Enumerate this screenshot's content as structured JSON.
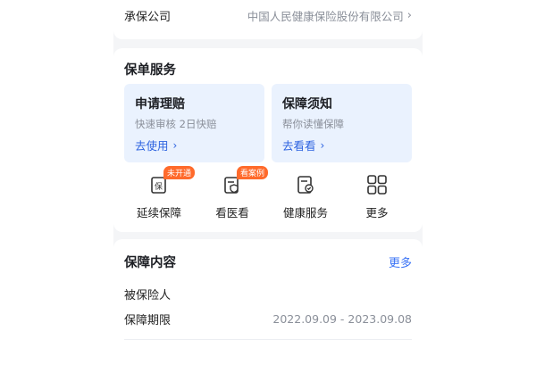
{
  "insurer": {
    "label": "承保公司",
    "value": "中国人民健康保险股份有限公司"
  },
  "policy_services": {
    "title": "保单服务",
    "tiles": [
      {
        "title": "申请理赔",
        "subtitle": "快速审核 2日快赔",
        "link": "去使用"
      },
      {
        "title": "保障须知",
        "subtitle": "帮你读懂保障",
        "link": "去看看"
      }
    ],
    "services": [
      {
        "label": "延续保障",
        "badge": "未开通",
        "icon": "policy-renew-icon"
      },
      {
        "label": "看医看",
        "badge": "看案例",
        "icon": "medical-shield-icon"
      },
      {
        "label": "健康服务",
        "badge": "",
        "icon": "health-doc-icon"
      },
      {
        "label": "更多",
        "badge": "",
        "icon": "grid-icon"
      }
    ]
  },
  "coverage": {
    "title": "保障内容",
    "more": "更多",
    "insured_label": "被保险人",
    "period_label": "保障期限",
    "period_value": "2022.09.09 - 2023.09.08"
  },
  "colors": {
    "accent": "#3a73f6",
    "tile_bg": "#eaf2fe",
    "badge": "#ff6a2b"
  }
}
